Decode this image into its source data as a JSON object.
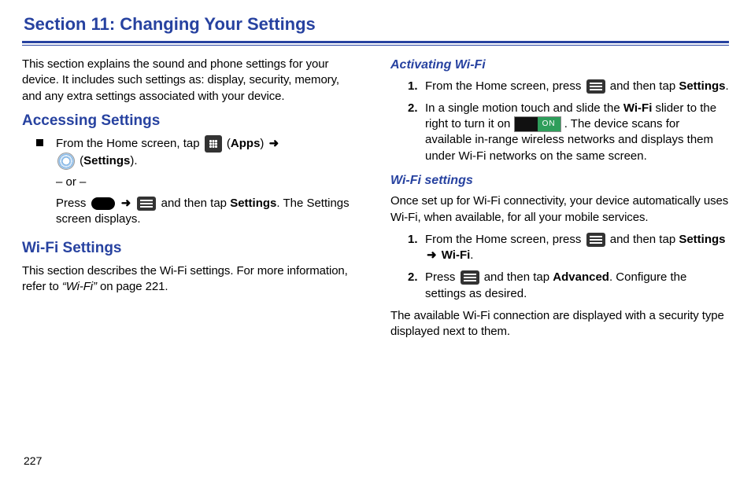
{
  "title": "Section 11: Changing Your Settings",
  "pageNumber": "227",
  "left": {
    "intro": "This section explains the sound and phone settings for your device. It includes such settings as: display, security, memory, and any extra settings associated with your device.",
    "h_access": "Accessing Settings",
    "access": {
      "b1_a": "From the Home screen, tap ",
      "b1_apps_open": " (",
      "b1_apps": "Apps",
      "b1_apps_close": ") ",
      "arrow": "➜",
      "b1_settings_open": " (",
      "b1_settings": "Settings",
      "b1_settings_close": ").",
      "or": "– or –",
      "b2_a": "Press ",
      "b2_b": " and then tap ",
      "b2_settings": "Settings",
      "b2_c": ". The Settings screen displays."
    },
    "h_wifi": "Wi-Fi Settings",
    "wifi_intro_a": "This section describes the Wi-Fi settings. For more information, refer to ",
    "wifi_ref": "“Wi-Fi”",
    "wifi_intro_b": "  on page 221."
  },
  "right": {
    "h_activating": "Activating Wi-Fi",
    "act": {
      "n1_a": "From the Home screen, press ",
      "n1_b": " and then tap ",
      "n1_settings": "Settings",
      "n1_c": ".",
      "n2_a": "In a single motion touch and slide the ",
      "n2_wifi": "Wi-Fi",
      "n2_b": " slider to the right to turn it on ",
      "switch_label": "ON",
      "n2_c": " . The device scans for available in-range wireless networks and displays them under Wi-Fi networks on the same screen."
    },
    "h_wifi_settings": "Wi-Fi settings",
    "wset_intro": "Once set up for Wi-Fi connectivity, your device automatically uses Wi-Fi, when available, for all your mobile services.",
    "wset": {
      "n1_a": "From the Home screen, press ",
      "n1_b": " and then tap ",
      "n1_settings": "Settings",
      "arrow": "➜",
      "n1_wifi": "Wi-Fi",
      "n1_c": ".",
      "n2_a": "Press ",
      "n2_b": " and then tap ",
      "n2_adv": "Advanced",
      "n2_c": ". Configure the settings as desired."
    },
    "wset_outro": "The available Wi-Fi connection are displayed with a security type displayed next to them."
  },
  "nums": {
    "one": "1.",
    "two": "2."
  }
}
